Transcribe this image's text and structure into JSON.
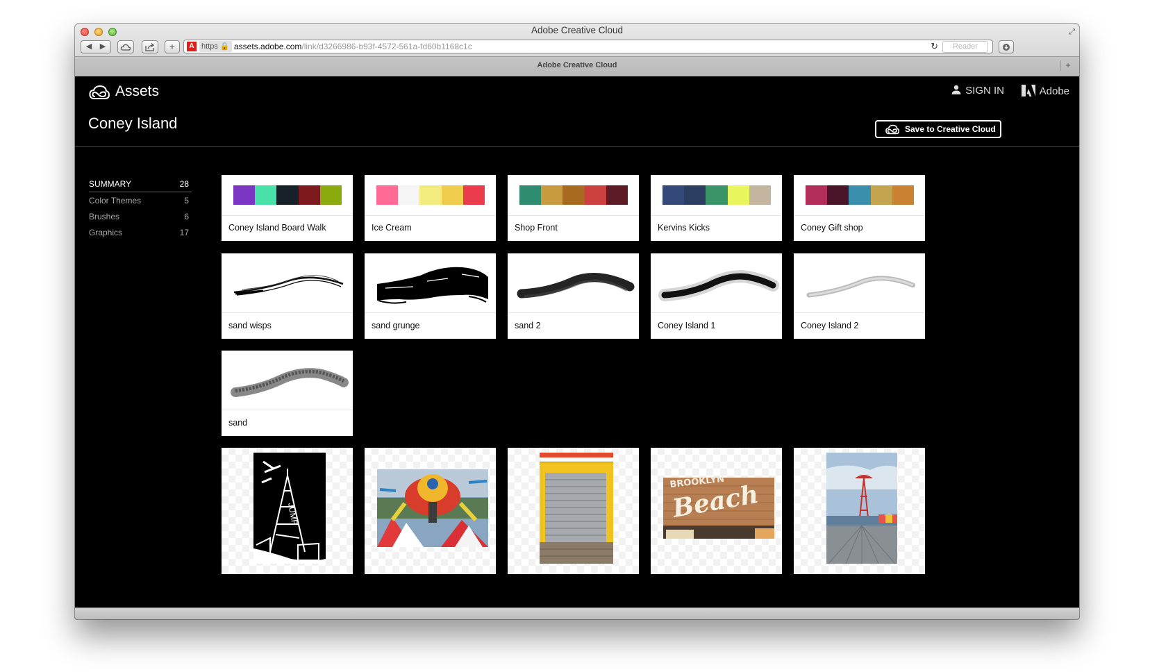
{
  "window": {
    "title": "Adobe Creative Cloud",
    "tab_title": "Adobe Creative Cloud"
  },
  "toolbar": {
    "back": "◀",
    "forward": "▶",
    "add": "+",
    "https": "https 🔒",
    "url_host": "assets.adobe.com",
    "url_path": "/link/d3266986-b93f-4572-561a-fd60b1168c1c",
    "reader": "Reader"
  },
  "header": {
    "app_name": "Assets",
    "sign_in": "SIGN IN",
    "adobe": "Adobe",
    "page_title": "Coney Island",
    "save_button": "Save to Creative Cloud"
  },
  "sidebar": {
    "items": [
      {
        "label": "SUMMARY",
        "count": "28"
      },
      {
        "label": "Color Themes",
        "count": "5"
      },
      {
        "label": "Brushes",
        "count": "6"
      },
      {
        "label": "Graphics",
        "count": "17"
      }
    ]
  },
  "color_themes": [
    {
      "name": "Coney Island Board Walk",
      "colors": [
        "#7d36c4",
        "#48e2a8",
        "#17212a",
        "#7c1a1d",
        "#8aaa0e"
      ]
    },
    {
      "name": "Ice Cream",
      "colors": [
        "#ff6b95",
        "#f5f5f5",
        "#f2ec7e",
        "#f1cd4e",
        "#ea3c4d"
      ]
    },
    {
      "name": "Shop Front",
      "colors": [
        "#2f8c70",
        "#c99b40",
        "#a86a1f",
        "#cc4140",
        "#5c1b25"
      ]
    },
    {
      "name": "Kervins Kicks",
      "colors": [
        "#34497a",
        "#2c3d62",
        "#399468",
        "#e9f55d",
        "#c3b5a0"
      ]
    },
    {
      "name": "Coney Gift shop",
      "colors": [
        "#b32d5a",
        "#4a1528",
        "#3a8fad",
        "#c5a44f",
        "#c98232"
      ]
    }
  ],
  "brushes": [
    {
      "name": "sand wisps",
      "icon": "thin-wisp-brush-stroke"
    },
    {
      "name": "sand grunge",
      "icon": "grunge-brush-stroke"
    },
    {
      "name": "sand 2",
      "icon": "soft-black-brush-stroke"
    },
    {
      "name": "Coney Island 1",
      "icon": "fuzzy-black-brush-stroke"
    },
    {
      "name": "Coney Island 2",
      "icon": "light-gray-brush-stroke"
    },
    {
      "name": "sand",
      "icon": "gray-sketch-brush-stroke"
    }
  ],
  "graphics": [
    {
      "icon": "black-and-white-tower-sketch"
    },
    {
      "icon": "amusement-ride-photo"
    },
    {
      "icon": "yellow-shuttered-shopfront-photo"
    },
    {
      "icon": "brooklyn-beach-sign-photo"
    },
    {
      "icon": "parachute-jump-boardwalk-photo"
    }
  ],
  "colors": {
    "page_background": "#000000",
    "card_background": "#ffffff",
    "text_muted": "#aaaaaa"
  }
}
